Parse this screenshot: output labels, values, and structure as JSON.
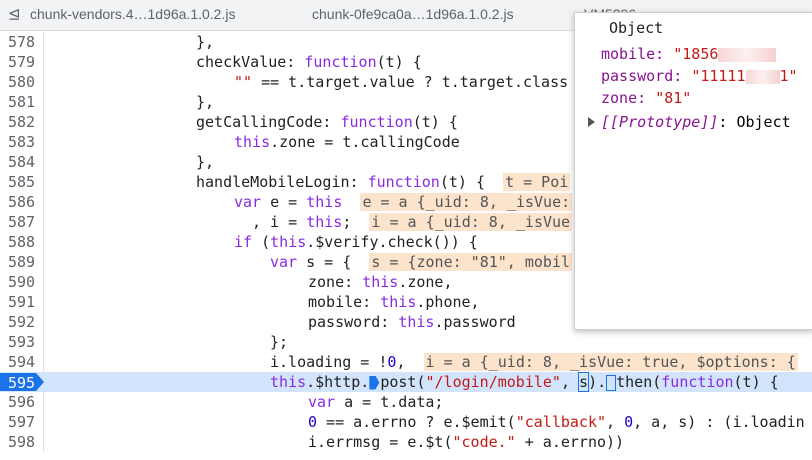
{
  "tabs": {
    "icon": "panel-dock-icon",
    "items": [
      {
        "label": "chunk-vendors.4…1d96a.1.0.2.js"
      },
      {
        "label": "chunk-0fe9ca0a…1d96a.1.0.2.js"
      },
      {
        "label": "VM5296"
      }
    ]
  },
  "code": {
    "lines": [
      {
        "n": "578"
      },
      {
        "n": "579"
      },
      {
        "n": "580"
      },
      {
        "n": "581"
      },
      {
        "n": "582"
      },
      {
        "n": "583"
      },
      {
        "n": "584"
      },
      {
        "n": "585"
      },
      {
        "n": "586"
      },
      {
        "n": "587"
      },
      {
        "n": "588"
      },
      {
        "n": "589"
      },
      {
        "n": "590"
      },
      {
        "n": "591"
      },
      {
        "n": "592"
      },
      {
        "n": "593"
      },
      {
        "n": "594"
      },
      {
        "n": "595"
      },
      {
        "n": "596"
      },
      {
        "n": "597"
      },
      {
        "n": "598"
      }
    ],
    "t578": "},",
    "t579a": "checkValue: ",
    "t579b": "function",
    "t579c": "(t) {",
    "t580a": "\"\"",
    "t580b": " == t.target.value ? t.target.class",
    "t581": "},",
    "t582a": "getCallingCode: ",
    "t582b": "function",
    "t582c": "(t) {",
    "t583a": "this",
    "t583b": ".zone = t.callingCode",
    "t584": "},",
    "t585a": "handleMobileLogin: ",
    "t585b": "function",
    "t585c": "(t) {  ",
    "t585d": "t = Poi",
    "t586a": "var",
    "t586b": " e = ",
    "t586c": "this",
    "t586d": "  ",
    "t586e": "e = a {_uid: 8, _isVue:",
    "t587a": ", i = ",
    "t587b": "this",
    "t587c": ";  ",
    "t587d": "i = a {_uid: 8, _isVue",
    "t588a": "if",
    "t588b": " (",
    "t588c": "this",
    "t588d": ".$verify.check()) {",
    "t589a": "var",
    "t589b": " s = {  ",
    "t589c": "s = {zone: \"81\", mobil",
    "t590a": "zone: ",
    "t590b": "this",
    "t590c": ".zone,",
    "t591a": "mobile: ",
    "t591b": "this",
    "t591c": ".phone,",
    "t592a": "password: ",
    "t592b": "this",
    "t592c": ".password",
    "t593": "};",
    "t594a": "i.loading = !",
    "t594b": "0",
    "t594c": ",  ",
    "t594d": "i = a {_uid: 8, _isVue: true, $options: {",
    "t595a": "this",
    "t595b": ".$http.",
    "t595c": "post(",
    "t595d": "\"/login/mobile\"",
    "t595e": ", ",
    "t595f": "s",
    "t595g": ").",
    "t595h": "then(",
    "t595i": "function",
    "t595j": "(t) {",
    "t596a": "var",
    "t596b": " a = t.data;",
    "t597a": "0",
    "t597b": " == a.errno ? e.$emit(",
    "t597c": "\"callback\"",
    "t597d": ", ",
    "t597e": "0",
    "t597f": ", a, s) : (i.loadin",
    "t598a": "i.errmsg = e.$t(",
    "t598b": "\"code.\"",
    "t598c": " + a.errno))"
  },
  "popup": {
    "title": "Object",
    "mobile_key": "mobile:",
    "mobile_val": "\"1856",
    "password_key": "password:",
    "password_val": "\"11111",
    "password_tail": "1\"",
    "zone_key": "zone:",
    "zone_val": "\"81\"",
    "proto_key": "[[Prototype]]",
    "proto_val": ": Object"
  }
}
